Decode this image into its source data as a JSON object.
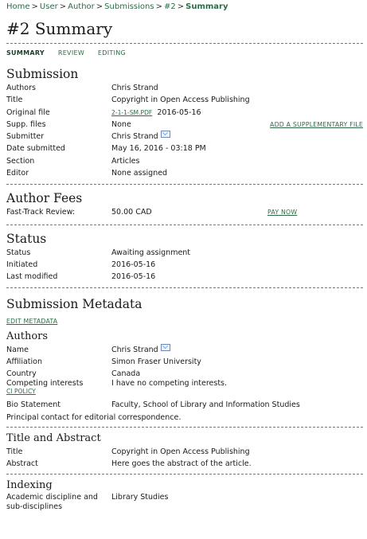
{
  "breadcrumb": {
    "items": [
      "Home",
      "User",
      "Author",
      "Submissions",
      "#2"
    ],
    "current": "Summary",
    "sep": ">"
  },
  "page_title": "#2 Summary",
  "tabs": {
    "summary": "SUMMARY",
    "review": "REVIEW",
    "editing": "EDITING"
  },
  "submission": {
    "heading": "Submission",
    "authors_label": "Authors",
    "authors": "Chris Strand",
    "title_label": "Title",
    "title": "Copyright in Open Access Publishing",
    "file_label": "Original file",
    "file_link": "2-1-1-SM.PDF",
    "file_date": "2016-05-16",
    "supp_label": "Supp. files",
    "supp": "None",
    "supp_action": "ADD A SUPPLEMENTARY FILE",
    "submitter_label": "Submitter",
    "submitter": "Chris Strand",
    "date_label": "Date submitted",
    "date": "May 16, 2016 - 03:18 PM",
    "section_label": "Section",
    "section": "Articles",
    "editor_label": "Editor",
    "editor": "None assigned"
  },
  "fees": {
    "heading": "Author Fees",
    "label": "Fast-Track Review:",
    "amount": "50.00 CAD",
    "action": "PAY NOW"
  },
  "status": {
    "heading": "Status",
    "status_label": "Status",
    "status": "Awaiting assignment",
    "initiated_label": "Initiated",
    "initiated": "2016-05-16",
    "modified_label": "Last modified",
    "modified": "2016-05-16"
  },
  "metadata": {
    "heading": "Submission Metadata",
    "edit_link": "EDIT METADATA",
    "authors_heading": "Authors",
    "name_label": "Name",
    "name": "Chris Strand",
    "affiliation_label": "Affiliation",
    "affiliation": "Simon Fraser University",
    "country_label": "Country",
    "country": "Canada",
    "ci_label": "Competing interests",
    "ci_link": "CI POLICY",
    "ci": "I have no competing interests.",
    "bio_label": "Bio Statement",
    "bio": "Faculty, School of Library and Information Studies",
    "principal": "Principal contact for editorial correspondence.",
    "ta_heading": "Title and Abstract",
    "ta_title_label": "Title",
    "ta_title": "Copyright in Open Access Publishing",
    "abstract_label": "Abstract",
    "abstract": "Here goes the abstract of the article.",
    "indexing_heading": "Indexing",
    "discipline_label_1": "Academic discipline and",
    "discipline_label_2": "sub-disciplines",
    "discipline": "Library Studies"
  }
}
